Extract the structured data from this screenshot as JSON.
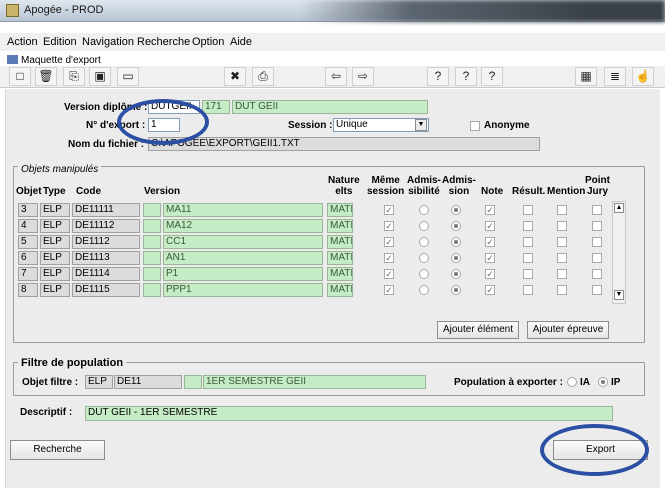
{
  "window": {
    "title": "Apogée - PROD",
    "icon": "app-icon"
  },
  "menu": [
    "Action",
    "Edition",
    "Navigation",
    "Recherche",
    "Option",
    "Aide"
  ],
  "form_title": "Maquette d'export",
  "toolbar": {
    "icons": [
      "new-icon",
      "delete-icon",
      "copy-icon",
      "save-icon",
      "screen-icon",
      "tools-icon",
      "print-icon",
      "arrow-left-icon",
      "arrow-right-icon",
      "help-query-icon",
      "help-icon",
      "help-book-icon",
      "calculator-icon",
      "list-icon",
      "hand-icon"
    ]
  },
  "version": {
    "label": "Version diplôme :",
    "code": "DUTGEII",
    "num": "171",
    "name": "DUT GEII"
  },
  "export": {
    "label": "N° d'export :",
    "value": "1",
    "session_label": "Session :",
    "session_value": "Unique",
    "anonyme_label": "Anonyme"
  },
  "fichier": {
    "label": "Nom du fichier :",
    "value": "C:\\APOGEE\\EXPORT\\GEII1.TXT"
  },
  "objets": {
    "title": "Objets manipulés",
    "headers": {
      "objet": "Objet",
      "type": "Type",
      "code": "Code",
      "version": "Version",
      "nature": [
        "Nature",
        "elts"
      ],
      "meme": [
        "Même",
        "session"
      ],
      "admissibilite": [
        "Admis-",
        "sibilité"
      ],
      "admission": [
        "Admis-",
        "sion"
      ],
      "note": "Note",
      "result": "Résult.",
      "mention": "Mention",
      "point": [
        "Point",
        "Jury"
      ]
    },
    "rows": [
      {
        "num": "3",
        "type": "ELP",
        "code": "DE11111",
        "version": "MA11",
        "nature": "MATI"
      },
      {
        "num": "4",
        "type": "ELP",
        "code": "DE11112",
        "version": "MA12",
        "nature": "MATI"
      },
      {
        "num": "5",
        "type": "ELP",
        "code": "DE1112",
        "version": "CC1",
        "nature": "MATI"
      },
      {
        "num": "6",
        "type": "ELP",
        "code": "DE1113",
        "version": "AN1",
        "nature": "MATI"
      },
      {
        "num": "7",
        "type": "ELP",
        "code": "DE1114",
        "version": "P1",
        "nature": "MATI"
      },
      {
        "num": "8",
        "type": "ELP",
        "code": "DE1115",
        "version": "PPP1",
        "nature": "MATI"
      }
    ],
    "add_element": "Ajouter élément",
    "add_epreuve": "Ajouter épreuve"
  },
  "filtre": {
    "title": "Filtre de population",
    "objet_label": "Objet filtre :",
    "type": "ELP",
    "code": "DE11",
    "libelle": "1ER SEMESTRE GEII",
    "pop_label": "Population à exporter :",
    "opt_ia": "IA",
    "opt_ip": "IP",
    "selected": "IP"
  },
  "descriptif": {
    "label": "Descriptif :",
    "value": "DUT GEII - 1ER SEMESTRE"
  },
  "buttons": {
    "recherche": "Recherche",
    "export": "Export"
  },
  "colors": {
    "green_field": "#c6ecc6",
    "annotation": "#2b4fa3"
  }
}
